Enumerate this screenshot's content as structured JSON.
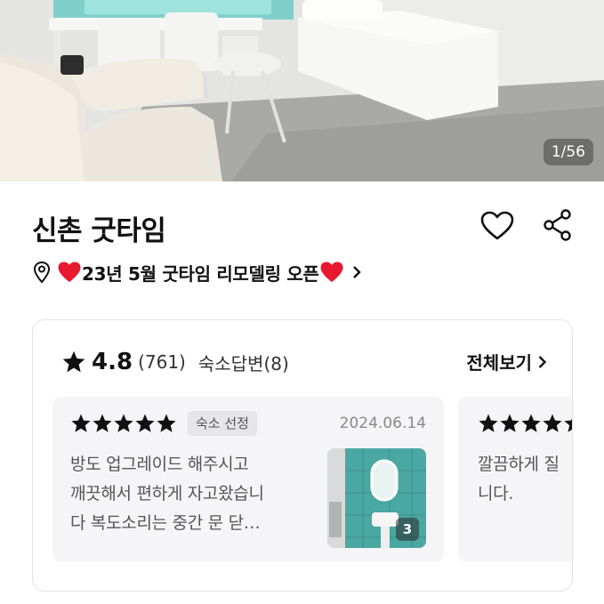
{
  "gallery": {
    "counter": "1/56"
  },
  "property": {
    "name": "신촌 굿타임"
  },
  "promo": {
    "text": "23년 5월 굿타임 리모델링 오픈"
  },
  "reviews": {
    "rating": "4.8",
    "count": "(761)",
    "reply_label": "숙소답변(8)",
    "view_all": "전체보기",
    "items": [
      {
        "stars": 5,
        "badge": "숙소 선정",
        "date": "2024.06.14",
        "text_lines": [
          "방도 업그레이드 해주시고",
          "깨끗해서 편하게 자고왔습니",
          "다 복도소리는 중간 문 닫…"
        ],
        "photo_count": "3"
      },
      {
        "stars": 5,
        "text_lines": [
          "깔끔하게 질",
          "니다."
        ]
      }
    ]
  },
  "colors": {
    "accent_heart": "#e8182e",
    "text": "#111111",
    "muted": "#888888"
  }
}
